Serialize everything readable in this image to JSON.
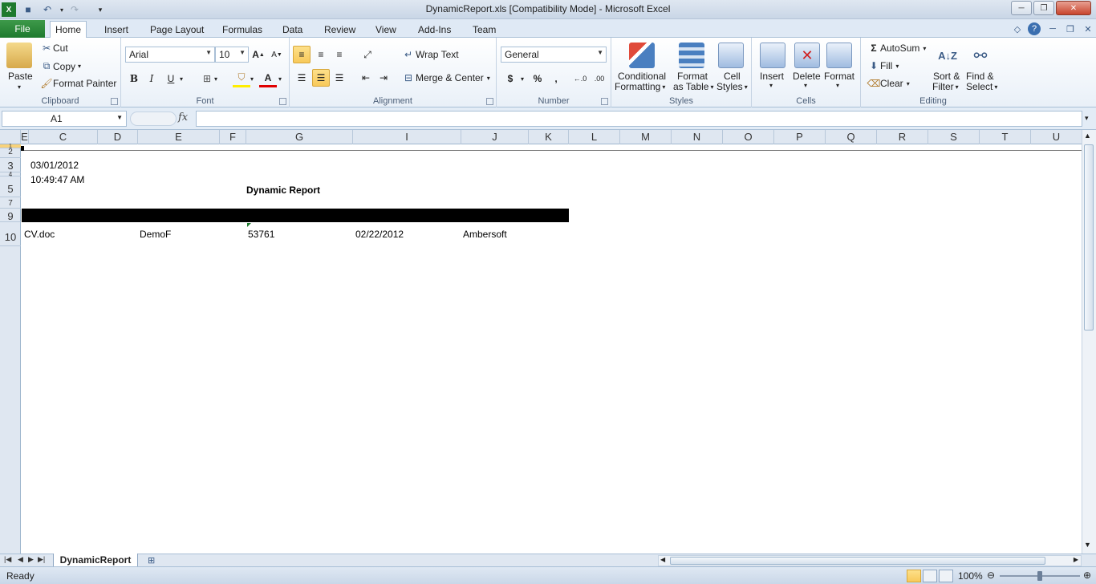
{
  "window": {
    "title": "DynamicReport.xls  [Compatibility Mode] - Microsoft Excel",
    "controls": {
      "minimize": "─",
      "maximize": "❐",
      "close": "✕"
    }
  },
  "ribbon_tabs": [
    "File",
    "Home",
    "Insert",
    "Page Layout",
    "Formulas",
    "Data",
    "Review",
    "View",
    "Add-Ins",
    "Team"
  ],
  "clipboard": {
    "paste": "Paste",
    "cut": "Cut",
    "copy": "Copy",
    "format_painter": "Format Painter",
    "label": "Clipboard"
  },
  "font": {
    "name": "Arial",
    "size": "10",
    "bold": "B",
    "italic": "I",
    "underline": "U",
    "label": "Font"
  },
  "alignment": {
    "wrap_text": "Wrap Text",
    "merge_center": "Merge & Center",
    "label": "Alignment"
  },
  "number": {
    "format": "General",
    "currency": "$",
    "percent": "%",
    "comma": ",",
    "label": "Number"
  },
  "styles": {
    "conditional_1": "Conditional",
    "conditional_2": "Formatting",
    "table_1": "Format",
    "table_2": "as Table",
    "cell_1": "Cell",
    "cell_2": "Styles",
    "label": "Styles"
  },
  "cells": {
    "insert": "Insert",
    "delete": "Delete",
    "format": "Format",
    "label": "Cells"
  },
  "editing": {
    "autosum": "AutoSum",
    "fill": "Fill",
    "clear": "Clear",
    "sort_1": "Sort &",
    "sort_2": "Filter",
    "find_1": "Find &",
    "find_2": "Select",
    "label": "Editing"
  },
  "formula_bar": {
    "name_box": "A1",
    "fx": "fx",
    "formula": ""
  },
  "columns": [
    "E",
    "C",
    "D",
    "E",
    "F",
    "G",
    "I",
    "J",
    "K",
    "L",
    "M",
    "N",
    "O",
    "P",
    "Q",
    "R",
    "S",
    "T",
    "U"
  ],
  "rows": [
    "1",
    "2",
    "3",
    "4",
    "5",
    "7",
    "9",
    "10"
  ],
  "cells_content": {
    "date": "03/01/2012",
    "time": "10:49:47 AM",
    "title": "Dynamic Report",
    "r10_file": "CV.doc",
    "r10_name": "DemoF",
    "r10_num": "53761",
    "r10_date": "02/22/2012",
    "r10_company": "Ambersoft"
  },
  "sheet": {
    "tab": "DynamicReport"
  },
  "status": {
    "ready": "Ready",
    "zoom": "100%",
    "zoom_fraction": 0.5
  },
  "colors": {
    "accent": "#1e7a2e",
    "selected": "#f8c95a"
  }
}
